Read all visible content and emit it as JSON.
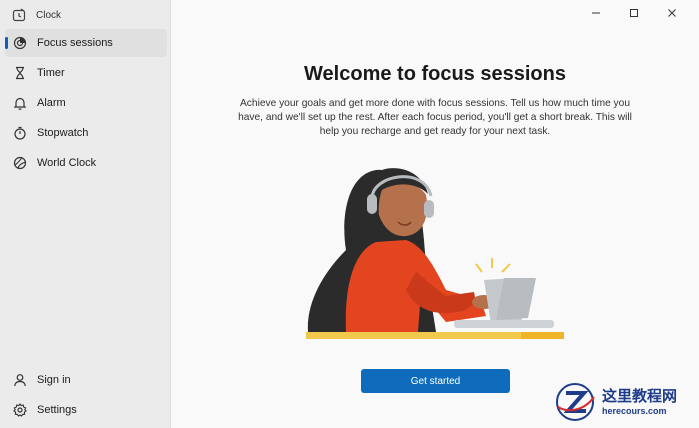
{
  "app": {
    "title": "Clock"
  },
  "sidebar": {
    "items": [
      {
        "label": "Focus sessions",
        "icon": "focus-icon",
        "active": true
      },
      {
        "label": "Timer",
        "icon": "hourglass-icon"
      },
      {
        "label": "Alarm",
        "icon": "bell-icon"
      },
      {
        "label": "Stopwatch",
        "icon": "stopwatch-icon"
      },
      {
        "label": "World Clock",
        "icon": "globe-icon"
      }
    ],
    "bottom": [
      {
        "label": "Sign in",
        "icon": "person-icon"
      },
      {
        "label": "Settings",
        "icon": "gear-icon"
      }
    ]
  },
  "main": {
    "heading": "Welcome to focus sessions",
    "description": "Achieve your goals and get more done with focus sessions. Tell us how much time you have, and we'll set up the rest. After each focus period, you'll get a short break. This will help you recharge and get ready for your next task.",
    "cta_label": "Get started"
  },
  "watermark": {
    "cn": "这里教程网",
    "en": "herecours.com"
  },
  "colors": {
    "accent": "#0f6cbd",
    "sidebar_bg": "#ebebeb",
    "main_bg": "#f9f9f9"
  }
}
